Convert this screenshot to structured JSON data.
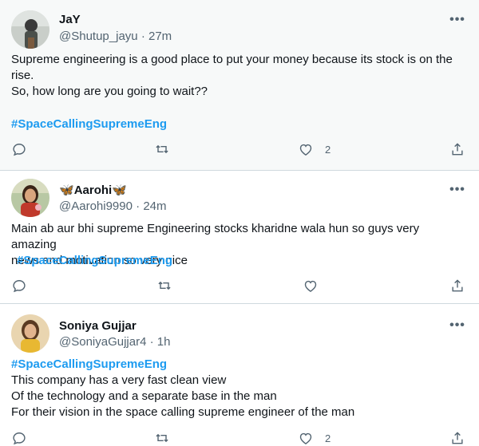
{
  "tweets": [
    {
      "name": "JaY",
      "handle": "@Shutup_jayu",
      "sep": "·",
      "time": "27m",
      "lines": [
        "Supreme engineering is a good place to put your money because its stock is on the",
        "rise.",
        "So, how long are you going to wait??"
      ],
      "hashtag": "#SpaceCallingSupremeEng",
      "likes": "2"
    },
    {
      "name": "Aarohi",
      "name_emoji": "🦋",
      "handle": "@Aarohi9990",
      "sep": "·",
      "time": "24m",
      "lines": [
        "Main ab aur bhi supreme Engineering stocks kharidne wala hun so guys very amazing",
        "news and motivation so very nice"
      ],
      "hashtag": "#SpaceCallingSupremeEng"
    },
    {
      "name": "Soniya Gujjar",
      "handle": "@SoniyaGujjar4",
      "sep": "·",
      "time": "1h",
      "hashtag": "#SpaceCallingSupremeEng",
      "lines": [
        "This company has a very fast clean view",
        "Of the technology and a separate base in the man",
        "For their vision in the space calling supreme engineer of the man"
      ],
      "likes": "2"
    }
  ],
  "icons": {
    "reply": "reply-icon",
    "retweet": "retweet-icon",
    "like": "heart-icon",
    "share": "share-icon",
    "more": "more-icon"
  },
  "colors": {
    "link": "#1d9bf0",
    "secondary_text": "#536471",
    "highlight_bg": "#f7f9f9"
  }
}
